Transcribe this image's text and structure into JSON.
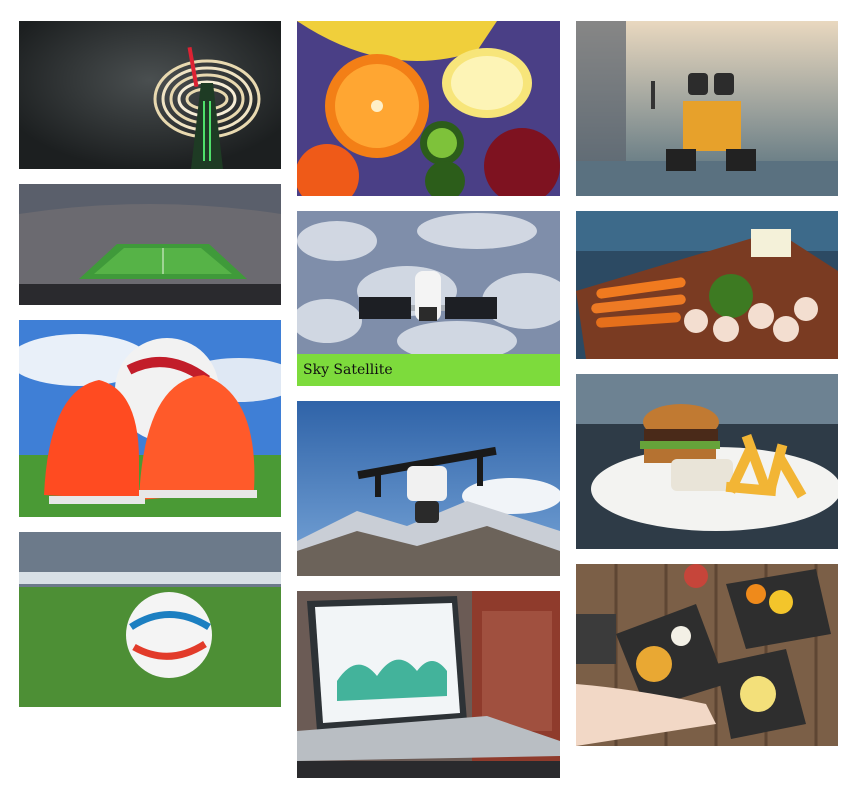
{
  "gallery": {
    "items": [
      {
        "id": "tile-light-tower",
        "caption": ""
      },
      {
        "id": "tile-stadium",
        "caption": ""
      },
      {
        "id": "tile-football-boots",
        "caption": ""
      },
      {
        "id": "tile-football-field",
        "caption": ""
      },
      {
        "id": "tile-fruits",
        "caption": ""
      },
      {
        "id": "tile-sky-satellite",
        "caption": "Sky Satellite"
      },
      {
        "id": "tile-drone",
        "caption": ""
      },
      {
        "id": "tile-laptop-dashboard",
        "caption": ""
      },
      {
        "id": "tile-robot-toy",
        "caption": ""
      },
      {
        "id": "tile-vegetables-board",
        "caption": ""
      },
      {
        "id": "tile-burger-fries",
        "caption": ""
      },
      {
        "id": "tile-food-table",
        "caption": ""
      }
    ]
  },
  "colors": {
    "caption_bg": "#7ddb3c",
    "page_bg": "#ffffff"
  }
}
